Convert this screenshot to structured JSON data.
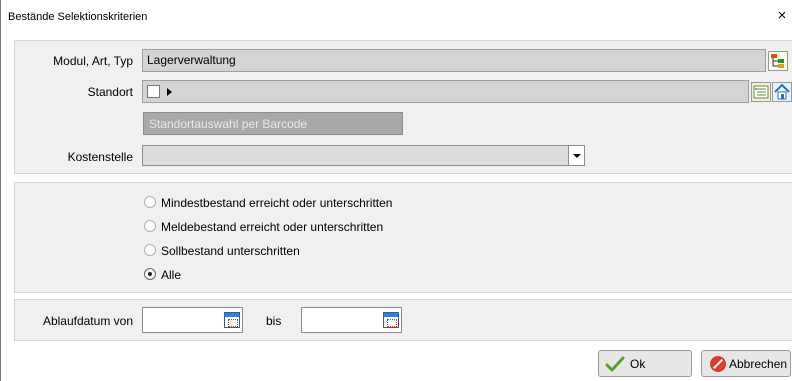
{
  "window": {
    "title": "Bestände Selektionskriterien",
    "close_glyph": "×"
  },
  "modul": {
    "label": "Modul, Art, Typ",
    "value": "Lagerverwaltung"
  },
  "standort": {
    "label": "Standort",
    "barcode_placeholder": "Standortauswahl per Barcode"
  },
  "kostenstelle": {
    "label": "Kostenstelle",
    "value": ""
  },
  "options": [
    {
      "label": "Mindestbestand erreicht oder unterschritten",
      "checked": false
    },
    {
      "label": "Meldebestand erreicht oder unterschritten",
      "checked": false
    },
    {
      "label": "Sollbestand unterschritten",
      "checked": false
    },
    {
      "label": "Alle",
      "checked": true
    }
  ],
  "ablauf": {
    "label": "Ablaufdatum von",
    "from_value": "",
    "to_label": "bis",
    "to_value": ""
  },
  "buttons": {
    "ok_label": "Ok",
    "cancel_label": "Abbrechen"
  }
}
